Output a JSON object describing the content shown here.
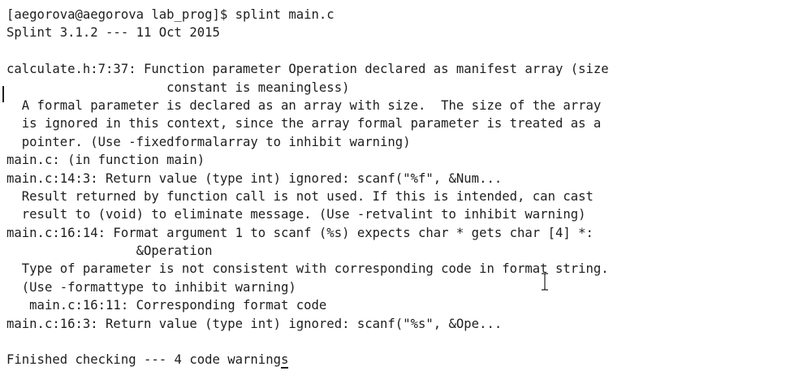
{
  "terminal": {
    "lines": [
      "[aegorova@aegorova lab_prog]$ splint main.c",
      "Splint 3.1.2 --- 11 Oct 2015",
      "",
      "calculate.h:7:37: Function parameter Operation declared as manifest array (size",
      "                     constant is meaningless)",
      "  A formal parameter is declared as an array with size.  The size of the array",
      "  is ignored in this context, since the array formal parameter is treated as a",
      "  pointer. (Use -fixedformalarray to inhibit warning)",
      "main.c: (in function main)",
      "main.c:14:3: Return value (type int) ignored: scanf(\"%f\", &Num...",
      "  Result returned by function call is not used. If this is intended, can cast",
      "  result to (void) to eliminate message. (Use -retvalint to inhibit warning)",
      "main.c:16:14: Format argument 1 to scanf (%s) expects char * gets char [4] *:",
      "                 &Operation",
      "  Type of parameter is not consistent with corresponding code in format string.",
      "  (Use -formattype to inhibit warning)",
      "   main.c:16:11: Corresponding format code",
      "main.c:16:3: Return value (type int) ignored: scanf(\"%s\", &Ope...",
      "",
      "Finished checking --- 4 code warnings"
    ]
  },
  "colors": {
    "background": "#ffffff",
    "text": "#1e1e1e"
  },
  "icons": {
    "text_cursor": "ibeam-cursor-icon"
  }
}
